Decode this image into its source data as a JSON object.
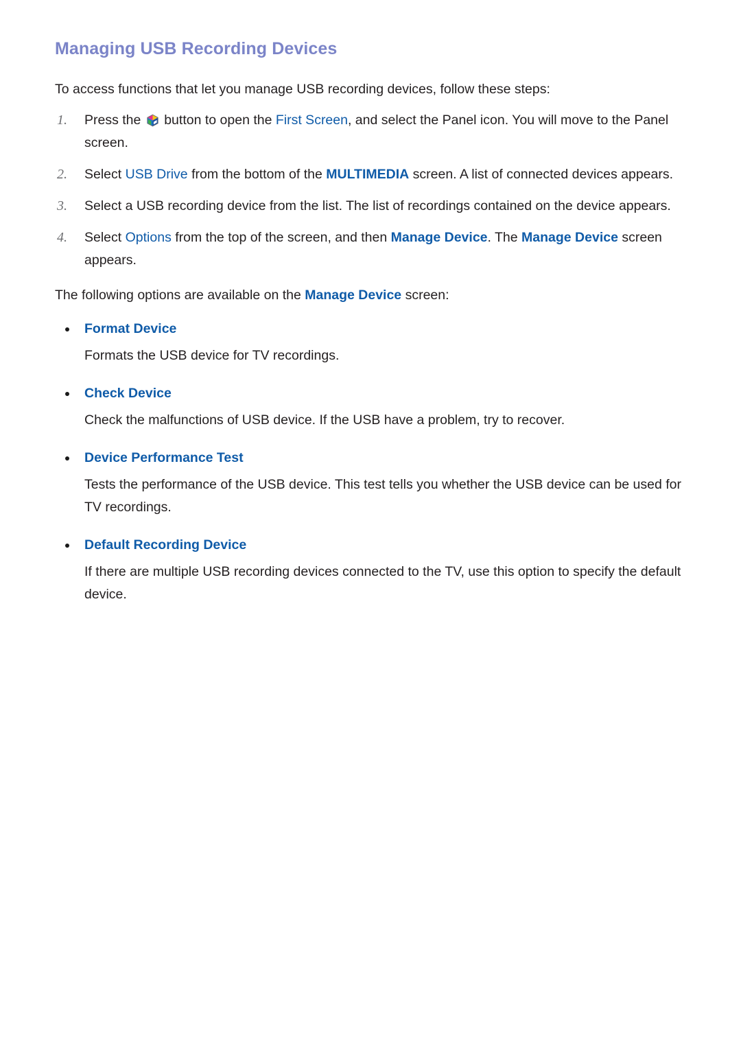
{
  "document": {
    "title": "Managing USB Recording Devices",
    "intro": "To access functions that let you manage USB recording devices, follow these steps:",
    "steps": [
      {
        "number": "1.",
        "pre_icon": "Press the",
        "icon": "smart-hub-cube-icon",
        "seg_a": " button to open the ",
        "link_a": "First Screen",
        "seg_b": ", and select the Panel icon. You will move to the Panel screen."
      },
      {
        "number": "2.",
        "seg_a": "Select ",
        "link_a": "USB Drive",
        "seg_b": " from the bottom of the ",
        "link_b": "MULTIMEDIA",
        "seg_c": " screen. A list of connected devices appears."
      },
      {
        "number": "3.",
        "seg_a": "Select a USB recording device from the list. The list of recordings contained on the device appears."
      },
      {
        "number": "4.",
        "seg_a": "Select ",
        "link_a": "Options",
        "seg_b": " from the top of the screen, and then ",
        "link_b": "Manage Device",
        "seg_c": ". The ",
        "link_c": "Manage Device",
        "seg_d": " screen appears."
      }
    ],
    "lead": {
      "seg_a": "The following options are available on the ",
      "link_a": "Manage Device",
      "seg_b": " screen:"
    },
    "options": [
      {
        "label": "Format Device",
        "description": "Formats the USB device for TV recordings."
      },
      {
        "label": "Check Device",
        "description": "Check the malfunctions of USB device. If the USB have a problem, try to recover."
      },
      {
        "label": "Device Performance Test",
        "description": "Tests the performance of the USB device. This test tells you whether the USB device can be used for TV recordings."
      },
      {
        "label": "Default Recording Device",
        "description": "If there are multiple USB recording devices connected to the TV, use this option to specify the default device."
      }
    ]
  },
  "colors": {
    "title": "#7b84c8",
    "link": "#0f5ba8",
    "body": "#231f20",
    "step_number": "#6d6e71",
    "background": "#ffffff"
  }
}
